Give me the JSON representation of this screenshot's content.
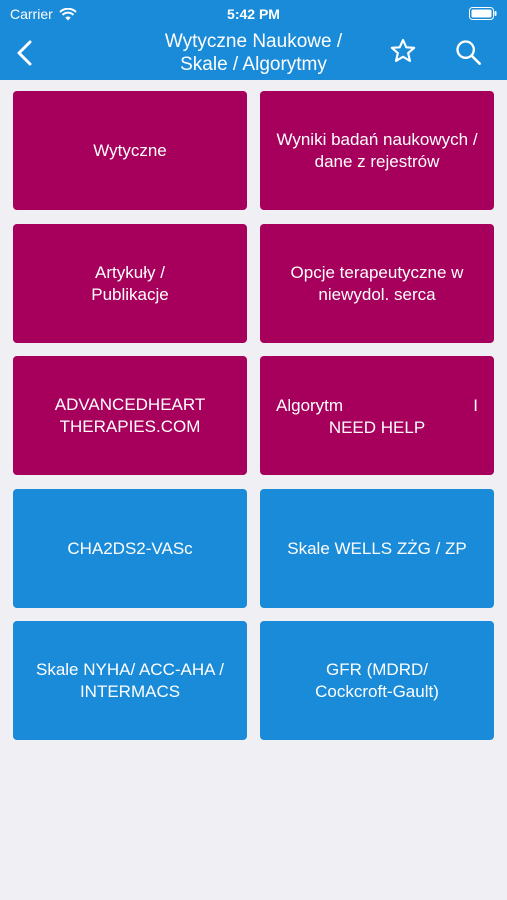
{
  "status_bar": {
    "carrier": "Carrier",
    "time": "5:42 PM"
  },
  "nav": {
    "title_line1": "Wytyczne Naukowe /",
    "title_line2": "Skale / Algorytmy"
  },
  "colors": {
    "header": "#1a8bd8",
    "magenta_tile": "#a6005c",
    "blue_tile": "#1a8bd8",
    "background": "#efeff4"
  },
  "tiles": {
    "t1": "Wytyczne",
    "t2": "Wyniki badań naukowych / dane z rejestrów",
    "t3_line1": "Artykuły /",
    "t3_line2": "Publikacje",
    "t4": "Opcje terapeutyczne w niewydol. serca",
    "t5_line1": "ADVANCEDHEART",
    "t5_line2": "THERAPIES.COM",
    "t6_left": "Algorytm",
    "t6_right": "I",
    "t6_line2": "NEED HELP",
    "t7": "CHA2DS2-VASc",
    "t8": "Skale WELLS ZŻG / ZP",
    "t9": "Skale NYHA/ ACC-AHA / INTERMACS",
    "t10_line1": "GFR (MDRD/",
    "t10_line2": "Cockcroft-Gault)"
  }
}
